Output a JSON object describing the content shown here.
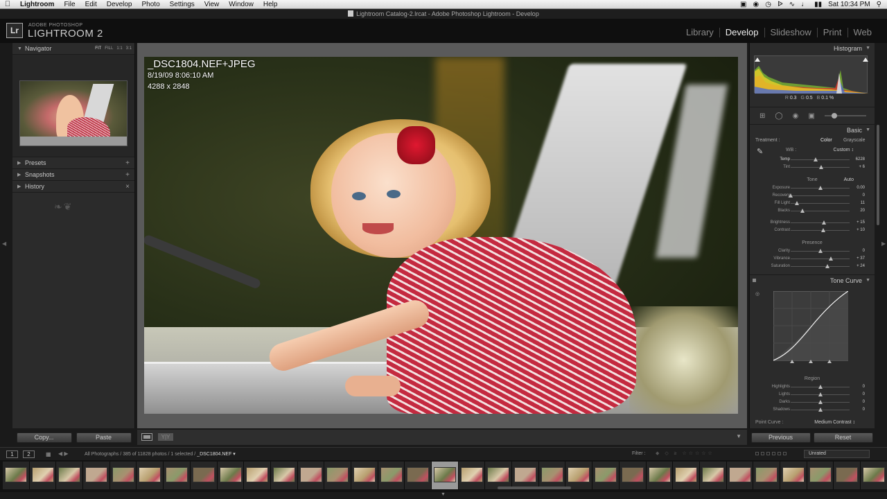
{
  "menubar": {
    "app": "Lightroom",
    "items": [
      "File",
      "Edit",
      "Develop",
      "Photo",
      "Settings",
      "View",
      "Window",
      "Help"
    ],
    "clock": "Sat 10:34 PM"
  },
  "window_title": "Lightroom Catalog-2.lrcat - Adobe Photoshop Lightroom - Develop",
  "identity": {
    "logo": "Lr",
    "small": "ADOBE PHOTOSHOP",
    "big": "LIGHTROOM 2"
  },
  "modules": [
    "Library",
    "Develop",
    "Slideshow",
    "Print",
    "Web"
  ],
  "left_panel": {
    "navigator": "Navigator",
    "zoom_opts": [
      "FIT",
      "FILL",
      "1:1",
      "3:1"
    ],
    "presets": "Presets",
    "snapshots": "Snapshots",
    "history": "History",
    "copy": "Copy...",
    "paste": "Paste"
  },
  "photo_info": {
    "name": "_DSC1804.NEF+JPEG",
    "date": "8/19/09 8:06:10 AM",
    "size": "4288 x 2848"
  },
  "toolbar": {
    "yy": "Y|Y"
  },
  "right_panel": {
    "histogram": "Histogram",
    "hist_vals": {
      "r_label": "R",
      "r": "0.3",
      "g_label": "G",
      "g": "0.5",
      "b_label": "B",
      "b": "0.1 %"
    },
    "basic": "Basic",
    "treatment_label": "Treatment :",
    "treatment_color": "Color",
    "treatment_gray": "Grayscale",
    "wb_label": "WB :",
    "wb_value": "Custom ↕",
    "tone": "Tone",
    "auto": "Auto",
    "presence": "Presence",
    "tone_curve": "Tone Curve",
    "region": "Region",
    "point_curve_label": "Point Curve :",
    "point_curve_value": "Medium Contrast ↕",
    "previous": "Previous",
    "reset": "Reset",
    "wb_sliders": [
      {
        "name": "Temp",
        "value": "6228",
        "pos": 0.42,
        "hl": true
      },
      {
        "name": "Tint",
        "value": "+ 6",
        "pos": 0.52,
        "hl": false
      }
    ],
    "tone_sliders": [
      {
        "name": "Exposure",
        "value": "0.00",
        "pos": 0.5
      },
      {
        "name": "Recovery",
        "value": "0",
        "pos": 0.0
      },
      {
        "name": "Fill Light",
        "value": "11",
        "pos": 0.11
      },
      {
        "name": "Blacks",
        "value": "20",
        "pos": 0.2
      }
    ],
    "tone_sliders2": [
      {
        "name": "Brightness",
        "value": "+ 15",
        "pos": 0.57
      },
      {
        "name": "Contrast",
        "value": "+ 10",
        "pos": 0.55
      }
    ],
    "presence_sliders": [
      {
        "name": "Clarity",
        "value": "0",
        "pos": 0.5
      },
      {
        "name": "Vibrance",
        "value": "+ 37",
        "pos": 0.68
      },
      {
        "name": "Saturation",
        "value": "+ 24",
        "pos": 0.62
      }
    ],
    "region_sliders": [
      {
        "name": "Highlights",
        "value": "0",
        "pos": 0.5
      },
      {
        "name": "Lights",
        "value": "0",
        "pos": 0.5
      },
      {
        "name": "Darks",
        "value": "0",
        "pos": 0.5
      },
      {
        "name": "Shadows",
        "value": "0",
        "pos": 0.5
      }
    ]
  },
  "filmstrip": {
    "screen1": "1",
    "screen2": "2",
    "path_prefix": "All Photographs / 385 of 11828 photos / 1 selected /",
    "path_file": "_DSC1804.NEF ▾",
    "filter": "Filter :",
    "rating": "Unrated",
    "thumb_count": 33,
    "selected_index": 16
  },
  "colors": {
    "accent": "#f0f0f0",
    "panel": "#2b2b2b",
    "center": "#5a5a5a"
  }
}
